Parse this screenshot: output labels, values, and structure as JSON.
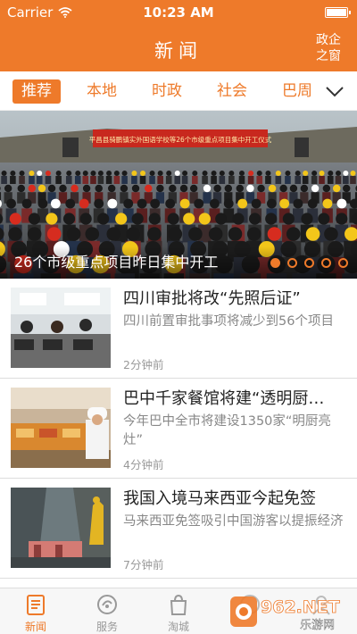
{
  "status_bar": {
    "carrier": "Carrier",
    "time": "10:23 AM"
  },
  "header": {
    "title": "新闻",
    "right_link": "政企\n之窗"
  },
  "tabs": [
    "推荐",
    "本地",
    "时政",
    "社会",
    "巴周"
  ],
  "banner": {
    "caption": "26个市级重点项目昨日集中开工",
    "sign_text": "平昌县骑鹏镇实外国语学校等26个市级重点项目集中开工仪式",
    "page_count": 5,
    "active_page": 1
  },
  "news": [
    {
      "title": "四川审批将改“先照后证”",
      "summary": "四川前置审批事项将减少到56个项目",
      "time": "2分钟前"
    },
    {
      "title": "巴中千家餐馆将建“透明厨…",
      "summary": "今年巴中全市将建设1350家“明厨亮灶”",
      "time": "4分钟前"
    },
    {
      "title": "我国入境马来西亚今起免签",
      "summary": "马来西亚免签吸引中国游客以提振经济",
      "time": "7分钟前"
    }
  ],
  "bottom_tabs": [
    {
      "label": "新闻",
      "icon": "news-icon",
      "active": true
    },
    {
      "label": "服务",
      "icon": "service-icon",
      "active": false
    },
    {
      "label": "淘城",
      "icon": "shopping-bag-icon",
      "active": false
    },
    {
      "label": "",
      "icon": "pay-icon",
      "active": false
    },
    {
      "label": "",
      "icon": "profile-icon",
      "active": false
    }
  ],
  "watermark": {
    "brand": "962.NET",
    "sub": "乐游网"
  },
  "colors": {
    "accent": "#ee7a2a",
    "text": "#222222",
    "muted": "#888888"
  }
}
